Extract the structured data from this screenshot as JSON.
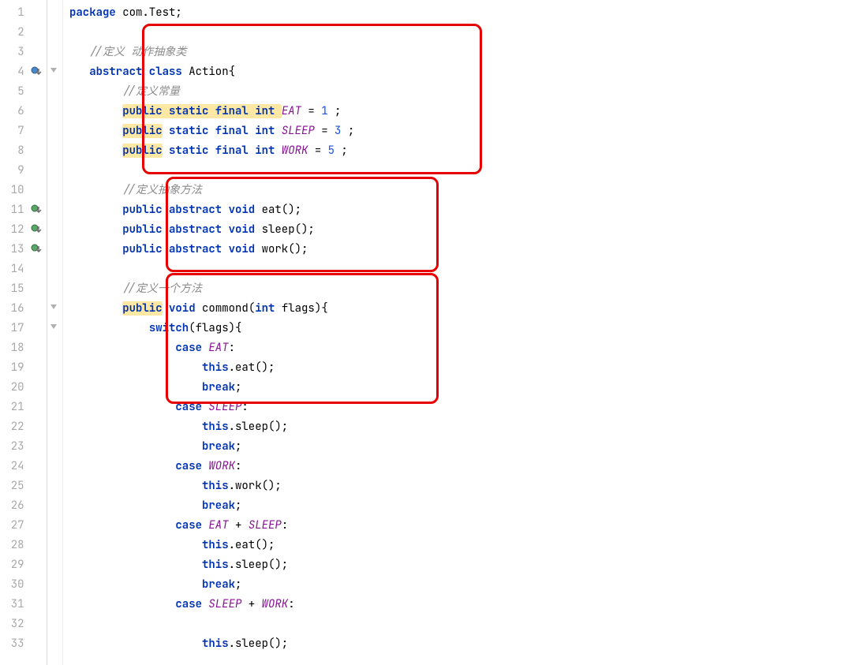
{
  "lines": {
    "1": [
      {
        "t": "package ",
        "c": "kw"
      },
      {
        "t": "com.Test;",
        "c": "ident"
      }
    ],
    "2": [],
    "3": [
      {
        "t": "   ",
        "c": ""
      },
      {
        "t": "//定义 动作抽象类",
        "c": "comment"
      }
    ],
    "4": [
      {
        "t": "   ",
        "c": ""
      },
      {
        "t": "abstract class ",
        "c": "kw"
      },
      {
        "t": "Action{",
        "c": "ident"
      }
    ],
    "5": [
      {
        "t": "        ",
        "c": ""
      },
      {
        "t": "//定义常量",
        "c": "comment"
      }
    ],
    "6": [
      {
        "t": "        ",
        "c": ""
      },
      {
        "t": "public static final int ",
        "c": "kw",
        "hl": true,
        "hlTokens": [
          {
            "t": "public",
            "hl": true
          },
          {
            "t": " static final int ",
            "hl": false
          }
        ]
      },
      {
        "t": "EAT",
        "c": "const"
      },
      {
        "t": " = ",
        "c": "punct"
      },
      {
        "t": "1",
        "c": "num-lit"
      },
      {
        "t": " ;",
        "c": "punct"
      }
    ],
    "7": [
      {
        "t": "        ",
        "c": ""
      },
      {
        "t": "public",
        "c": "kw",
        "hl": true
      },
      {
        "t": " static final int ",
        "c": "kw"
      },
      {
        "t": "SLEEP",
        "c": "const"
      },
      {
        "t": " = ",
        "c": "punct"
      },
      {
        "t": "3",
        "c": "num-lit"
      },
      {
        "t": " ;",
        "c": "punct"
      }
    ],
    "8": [
      {
        "t": "        ",
        "c": ""
      },
      {
        "t": "public",
        "c": "kw",
        "hl": true
      },
      {
        "t": " static final int ",
        "c": "kw"
      },
      {
        "t": "WORK",
        "c": "const"
      },
      {
        "t": " = ",
        "c": "punct"
      },
      {
        "t": "5",
        "c": "num-lit"
      },
      {
        "t": " ;",
        "c": "punct"
      }
    ],
    "9": [],
    "10": [
      {
        "t": "        ",
        "c": ""
      },
      {
        "t": "//定义抽象方法",
        "c": "comment"
      }
    ],
    "11": [
      {
        "t": "        ",
        "c": ""
      },
      {
        "t": "public abstract void ",
        "c": "kw"
      },
      {
        "t": "eat();",
        "c": "ident"
      }
    ],
    "12": [
      {
        "t": "        ",
        "c": ""
      },
      {
        "t": "public abstract void ",
        "c": "kw"
      },
      {
        "t": "sleep();",
        "c": "ident"
      }
    ],
    "13": [
      {
        "t": "        ",
        "c": ""
      },
      {
        "t": "public abstract void ",
        "c": "kw"
      },
      {
        "t": "work();",
        "c": "ident"
      }
    ],
    "14": [],
    "15": [
      {
        "t": "        ",
        "c": ""
      },
      {
        "t": "//定义一个方法",
        "c": "comment"
      }
    ],
    "16": [
      {
        "t": "        ",
        "c": ""
      },
      {
        "t": "public",
        "c": "kw",
        "hl": true
      },
      {
        "t": " void ",
        "c": "kw"
      },
      {
        "t": "commond(",
        "c": "ident"
      },
      {
        "t": "int ",
        "c": "kw"
      },
      {
        "t": "flags){",
        "c": "ident"
      }
    ],
    "17": [
      {
        "t": "            ",
        "c": ""
      },
      {
        "t": "switch",
        "c": "kw"
      },
      {
        "t": "(flags){",
        "c": "ident"
      }
    ],
    "18": [
      {
        "t": "                ",
        "c": ""
      },
      {
        "t": "case ",
        "c": "kw"
      },
      {
        "t": "EAT",
        "c": "const"
      },
      {
        "t": ":",
        "c": "punct"
      }
    ],
    "19": [
      {
        "t": "                    ",
        "c": ""
      },
      {
        "t": "this",
        "c": "kw"
      },
      {
        "t": ".eat();",
        "c": "ident"
      }
    ],
    "20": [
      {
        "t": "                    ",
        "c": ""
      },
      {
        "t": "break",
        "c": "kw"
      },
      {
        "t": ";",
        "c": "punct"
      }
    ],
    "21": [
      {
        "t": "                ",
        "c": ""
      },
      {
        "t": "case ",
        "c": "kw"
      },
      {
        "t": "SLEEP",
        "c": "const"
      },
      {
        "t": ":",
        "c": "punct"
      }
    ],
    "22": [
      {
        "t": "                    ",
        "c": ""
      },
      {
        "t": "this",
        "c": "kw"
      },
      {
        "t": ".sleep();",
        "c": "ident"
      }
    ],
    "23": [
      {
        "t": "                    ",
        "c": ""
      },
      {
        "t": "break",
        "c": "kw"
      },
      {
        "t": ";",
        "c": "punct"
      }
    ],
    "24": [
      {
        "t": "                ",
        "c": ""
      },
      {
        "t": "case ",
        "c": "kw"
      },
      {
        "t": "WORK",
        "c": "const"
      },
      {
        "t": ":",
        "c": "punct"
      }
    ],
    "25": [
      {
        "t": "                    ",
        "c": ""
      },
      {
        "t": "this",
        "c": "kw"
      },
      {
        "t": ".work();",
        "c": "ident"
      }
    ],
    "26": [
      {
        "t": "                    ",
        "c": ""
      },
      {
        "t": "break",
        "c": "kw"
      },
      {
        "t": ";",
        "c": "punct"
      }
    ],
    "27": [
      {
        "t": "                ",
        "c": ""
      },
      {
        "t": "case ",
        "c": "kw"
      },
      {
        "t": "EAT",
        "c": "const"
      },
      {
        "t": " + ",
        "c": "punct"
      },
      {
        "t": "SLEEP",
        "c": "const"
      },
      {
        "t": ":",
        "c": "punct"
      }
    ],
    "28": [
      {
        "t": "                    ",
        "c": ""
      },
      {
        "t": "this",
        "c": "kw"
      },
      {
        "t": ".eat();",
        "c": "ident"
      }
    ],
    "29": [
      {
        "t": "                    ",
        "c": ""
      },
      {
        "t": "this",
        "c": "kw"
      },
      {
        "t": ".sleep();",
        "c": "ident"
      }
    ],
    "30": [
      {
        "t": "                    ",
        "c": ""
      },
      {
        "t": "break",
        "c": "kw"
      },
      {
        "t": ";",
        "c": "punct"
      }
    ],
    "31": [
      {
        "t": "                ",
        "c": ""
      },
      {
        "t": "case ",
        "c": "kw"
      },
      {
        "t": "SLEEP",
        "c": "const"
      },
      {
        "t": " + ",
        "c": "punct"
      },
      {
        "t": "WORK",
        "c": "const"
      },
      {
        "t": ":",
        "c": "punct"
      }
    ],
    "32": [],
    "33": [
      {
        "t": "                    ",
        "c": ""
      },
      {
        "t": "this",
        "c": "kw"
      },
      {
        "t": ".sleep();",
        "c": "ident"
      }
    ]
  },
  "lineCount": 33,
  "gutterAnnotations": {
    "4": "override-down-blue",
    "11": "impl-down-green",
    "12": "impl-down-green",
    "13": "impl-down-green"
  },
  "foldMarkers": [
    4,
    16,
    17
  ]
}
